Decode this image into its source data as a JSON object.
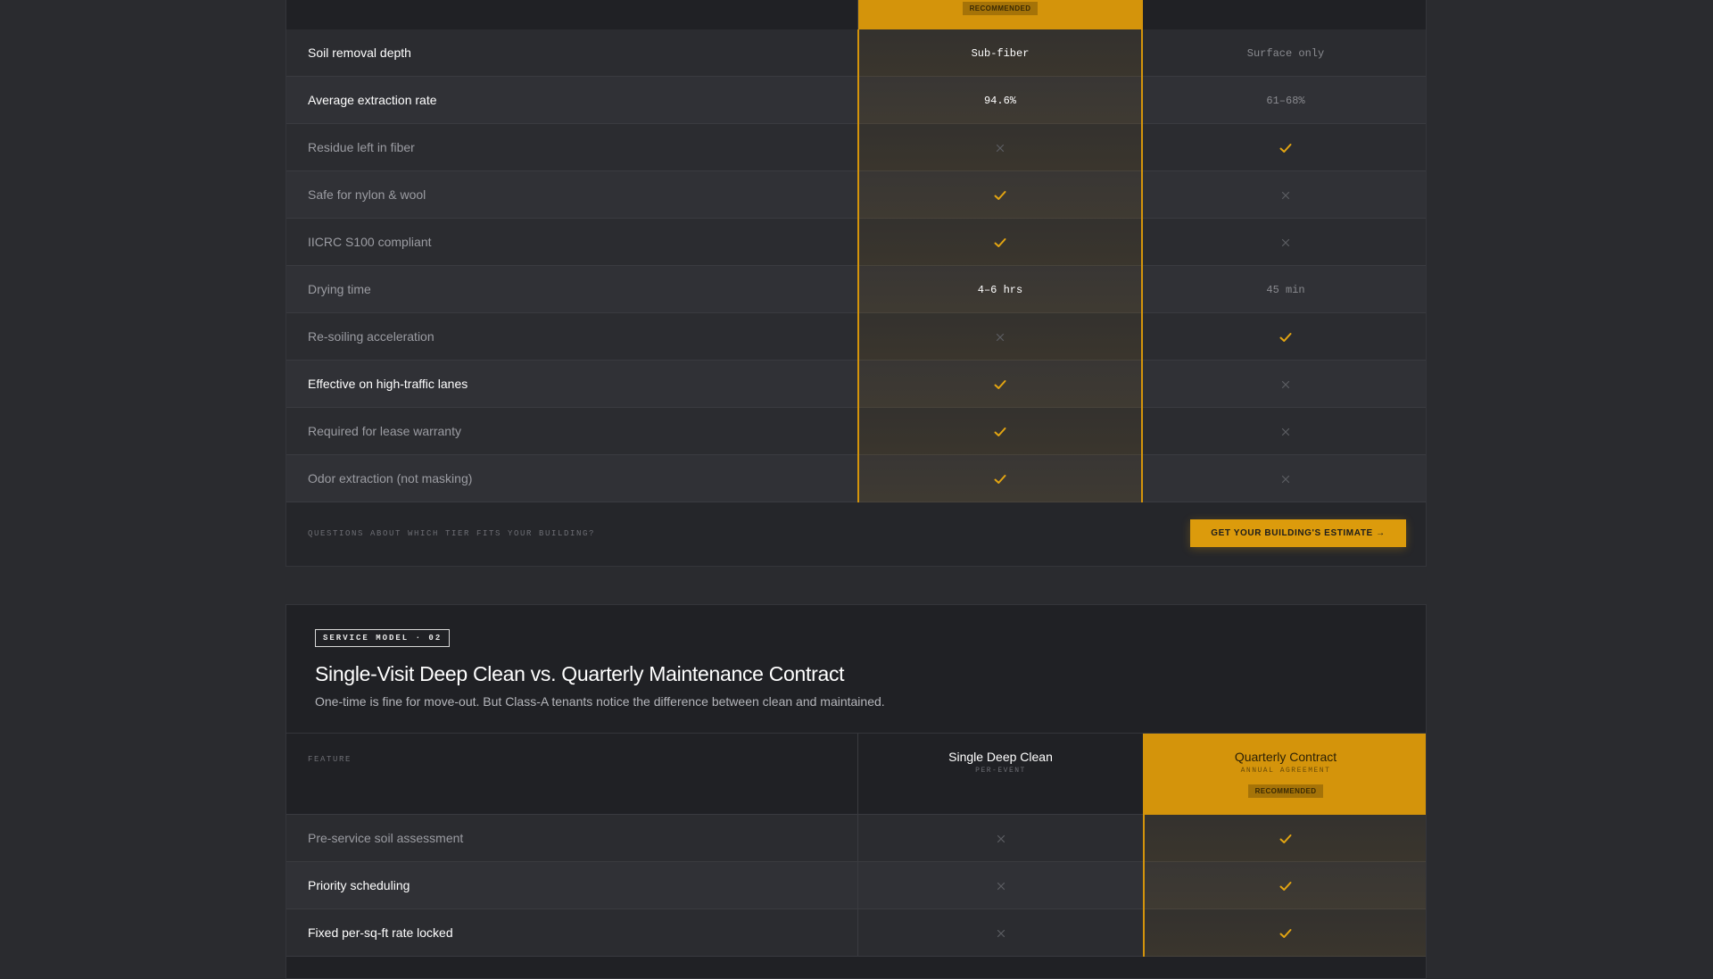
{
  "table1": {
    "badge": "RECOMMENDED",
    "rows": [
      {
        "feature": "Soil removal depth",
        "rec": "Sub-fiber",
        "other": "Surface only"
      },
      {
        "feature": "Average extraction rate",
        "rec": "94.6%",
        "other": "61–68%"
      },
      {
        "feature": "Residue left in fiber",
        "rec": "no",
        "other": "yes"
      },
      {
        "feature": "Safe for nylon & wool",
        "rec": "yes",
        "other": "no"
      },
      {
        "feature": "IICRC S100 compliant",
        "rec": "yes",
        "other": "no"
      },
      {
        "feature": "Drying time",
        "rec": "4–6 hrs",
        "other": "45 min"
      },
      {
        "feature": "Re-soiling acceleration",
        "rec": "no",
        "other": "yes"
      },
      {
        "feature": "Effective on high-traffic lanes",
        "rec": "yes",
        "other": "no"
      },
      {
        "feature": "Required for lease warranty",
        "rec": "yes",
        "other": "no"
      },
      {
        "feature": "Odor extraction (not masking)",
        "rec": "yes",
        "other": "no"
      }
    ],
    "footer_question": "QUESTIONS ABOUT WHICH TIER FITS YOUR BUILDING?",
    "cta_label": "GET YOUR BUILDING'S ESTIMATE →"
  },
  "table2": {
    "tag": "SERVICE MODEL · 02",
    "title": "Single-Visit Deep Clean vs. Quarterly Maintenance Contract",
    "subtitle": "One-time is fine for move-out. But Class-A tenants notice the difference between clean and maintained.",
    "feature_header": "FEATURE",
    "col1": {
      "name": "Single Deep Clean",
      "sub": "PER-EVENT"
    },
    "col2": {
      "name": "Quarterly Contract",
      "sub": "ANNUAL AGREEMENT",
      "badge": "RECOMMENDED"
    },
    "rows": [
      {
        "feature": "Pre-service soil assessment",
        "single": "no",
        "quarterly": "yes"
      },
      {
        "feature": "Priority scheduling",
        "single": "no",
        "quarterly": "yes"
      },
      {
        "feature": "Fixed per-sq-ft rate locked",
        "single": "no",
        "quarterly": "yes"
      }
    ]
  },
  "colors": {
    "accent": "#d4940b",
    "background": "#2a2b2f",
    "card": "#202125"
  }
}
